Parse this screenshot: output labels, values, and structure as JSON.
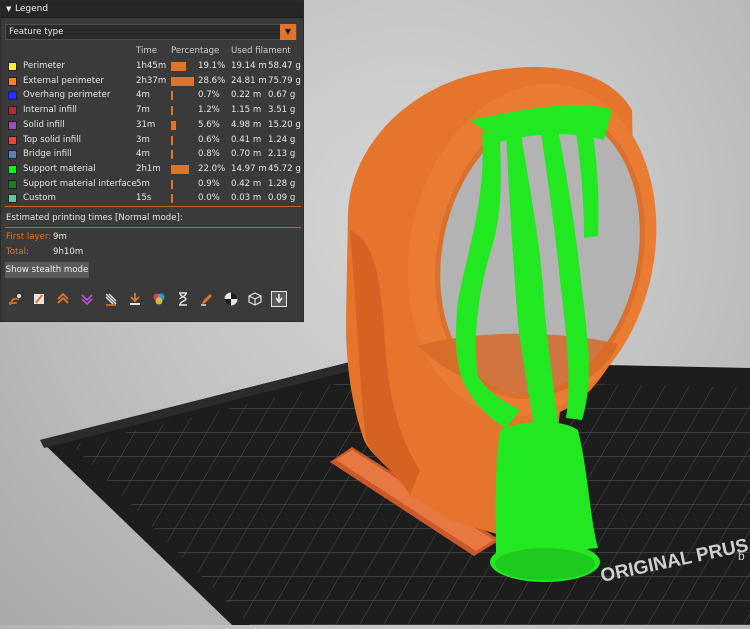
{
  "legend": {
    "title": "Legend",
    "view_type": "Feature type",
    "columns": {
      "time": "Time",
      "percentage": "Percentage",
      "filament": "Used filament"
    },
    "rows": [
      {
        "name": "Perimeter",
        "color": "#ffe84d",
        "time": "1h45m",
        "pct": 19.1,
        "pct_text": "19.1%",
        "length": "19.14 m",
        "weight": "58.47 g"
      },
      {
        "name": "External perimeter",
        "color": "#f58330",
        "time": "2h37m",
        "pct": 28.6,
        "pct_text": "28.6%",
        "length": "24.81 m",
        "weight": "75.79 g"
      },
      {
        "name": "Overhang perimeter",
        "color": "#1f33ff",
        "time": "4m",
        "pct": 0.7,
        "pct_text": "0.7%",
        "length": "0.22 m",
        "weight": "0.67 g"
      },
      {
        "name": "Internal infill",
        "color": "#b12c2e",
        "time": "7m",
        "pct": 1.2,
        "pct_text": "1.2%",
        "length": "1.15 m",
        "weight": "3.51 g"
      },
      {
        "name": "Solid infill",
        "color": "#9a4fc1",
        "time": "31m",
        "pct": 5.6,
        "pct_text": "5.6%",
        "length": "4.98 m",
        "weight": "15.20 g"
      },
      {
        "name": "Top solid infill",
        "color": "#f2403a",
        "time": "3m",
        "pct": 0.6,
        "pct_text": "0.6%",
        "length": "0.41 m",
        "weight": "1.24 g"
      },
      {
        "name": "Bridge infill",
        "color": "#5a82b4",
        "time": "4m",
        "pct": 0.8,
        "pct_text": "0.8%",
        "length": "0.70 m",
        "weight": "2.13 g"
      },
      {
        "name": "Support material",
        "color": "#22e822",
        "time": "2h1m",
        "pct": 22.0,
        "pct_text": "22.0%",
        "length": "14.97 m",
        "weight": "45.72 g"
      },
      {
        "name": "Support material interface",
        "color": "#1e7d1e",
        "time": "5m",
        "pct": 0.9,
        "pct_text": "0.9%",
        "length": "0.42 m",
        "weight": "1.28 g"
      },
      {
        "name": "Custom",
        "color": "#5fc79a",
        "time": "15s",
        "pct": 0.0,
        "pct_text": "0.0%",
        "length": "0.03 m",
        "weight": "0.09 g"
      }
    ],
    "estimated_title": "Estimated printing times [Normal mode]:",
    "first_layer_label": "First layer:",
    "first_layer_value": "9m",
    "total_label": "Total:",
    "total_value": "9h10m",
    "stealth_button": "Show stealth mode",
    "toolbar_icons": [
      "travel-icon",
      "wipe-icon",
      "retractions-icon",
      "deretractions-icon",
      "seams-icon",
      "tool-changes-icon",
      "color-changes-icon",
      "pause-icon",
      "custom-gcode-icon",
      "center-of-gravity-icon",
      "shells-icon",
      "tool-marker-icon"
    ]
  },
  "bed": {
    "brand_text": "ORIGINAL PRUSA",
    "brand_sub": "b"
  },
  "colors": {
    "accent": "#e0742b",
    "panel": "#3a3a3a",
    "model_orange": "#e5742c",
    "support_green": "#22e822"
  }
}
